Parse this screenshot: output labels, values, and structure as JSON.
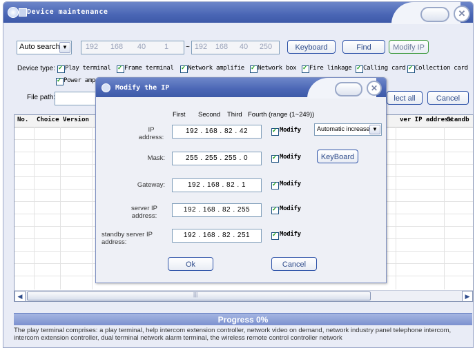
{
  "window": {
    "title": "Device maintenance"
  },
  "toolbar": {
    "search_mode": "Auto search",
    "ip_start": [
      "192",
      "168",
      "40",
      "1"
    ],
    "range_sep": "~",
    "ip_end": [
      "192",
      "168",
      "40",
      "250"
    ],
    "keyboard_label": "Keyboard",
    "find_label": "Find",
    "modify_ip_label": "Modify IP"
  },
  "device_type": {
    "label": "Device type:",
    "options": [
      "Play terminal",
      "Frame terminal",
      "Network amplifie",
      "Network box",
      "Fire linkage",
      "Calling card",
      "Collection card"
    ],
    "row2_options": [
      "Power amp"
    ]
  },
  "file_path": {
    "label": "File path:",
    "select_all_label": "lect all",
    "cancel_label": "Cancel"
  },
  "table": {
    "columns_left": [
      "No.",
      "Choice",
      "Version"
    ],
    "columns_right": [
      "ver IP address",
      "Standb"
    ]
  },
  "scrollbar": {
    "mid_mark": "|||"
  },
  "progress": {
    "label": "Progress 0%"
  },
  "description": "The play terminal comprises: a play terminal, help intercom extension controller, network video on demand, network industry panel telephone intercom, intercom extension controller, dual terminal network alarm terminal, the wireless remote control controller network",
  "dialog": {
    "title": "Modify the IP",
    "header": {
      "first": "First",
      "second": "Second",
      "third": "Third",
      "fourth": "Fourth",
      "range": "(range (1~249))"
    },
    "fields": [
      {
        "label": "IP address:",
        "value": "192 . 168 . 82 . 42",
        "modify": "Modify"
      },
      {
        "label": "Mask:",
        "value": "255 . 255 . 255 . 0",
        "modify": "Modify"
      },
      {
        "label": "Gateway:",
        "value": "192 . 168 . 82 . 1",
        "modify": "Modify"
      },
      {
        "label": "server IP address:",
        "value": "192 . 168 . 82 . 255",
        "modify": "Modify"
      },
      {
        "label": "standby server IP address:",
        "value": "192 . 168 . 82 . 251",
        "modify": "Modify"
      }
    ],
    "auto_increase": "Automatic increase",
    "keyboard_label": "KeyBoard",
    "ok_label": "Ok",
    "cancel_label": "Cancel"
  }
}
